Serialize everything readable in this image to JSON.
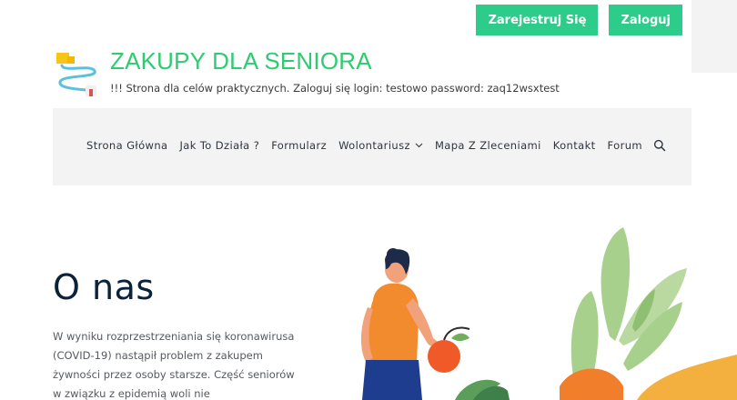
{
  "header": {
    "register_label": "Zarejestruj Się",
    "login_label": "Zaloguj"
  },
  "brand": {
    "title": "ZAKUPY DLA SENIORA",
    "tagline": "!!! Strona dla celów praktycznych. Zaloguj się login: testowo password: zaq12wsxtest"
  },
  "nav": {
    "items": [
      {
        "label": "Strona Główna"
      },
      {
        "label": "Jak To Działa ?"
      },
      {
        "label": "Formularz"
      },
      {
        "label": "Wolontariusz"
      },
      {
        "label": "Mapa Z Zleceniami"
      },
      {
        "label": "Kontakt"
      },
      {
        "label": "Forum"
      }
    ]
  },
  "about": {
    "heading": "O nas",
    "text": "W wyniku rozprzestrzeniania się koronawirusa (COVID-19) nastąpił problem z zakupem żywności przez osoby starsze. Część seniorów w związku z epidemią woli nie"
  },
  "colors": {
    "accent": "#2ecc8a",
    "title": "#2ecc71",
    "nav_bg": "#f3f3f3",
    "heading": "#0b2238"
  },
  "icons": {
    "search": "search-icon",
    "chevron": "chevron-down-icon"
  }
}
